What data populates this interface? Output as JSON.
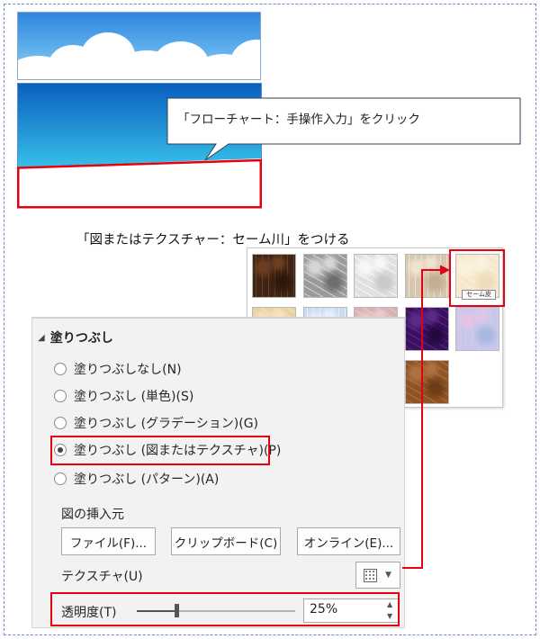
{
  "callout": {
    "text": "「フローチャート：手操作入力」をクリック"
  },
  "caption": {
    "text": "「図またはテクスチャー：セーム川」をつける"
  },
  "texture_gallery": {
    "tooltip": "セーム皮",
    "textures": [
      {
        "name": "texture-brown-marble",
        "colors": [
          "#3e2414",
          "#6b3e22",
          "#2d180c"
        ]
      },
      {
        "name": "texture-granite",
        "colors": [
          "#9a9a9a",
          "#d6d6d6",
          "#6e6e6e"
        ]
      },
      {
        "name": "texture-white-marble",
        "colors": [
          "#e0e0e0",
          "#f7f7f7",
          "#c9c9c9"
        ]
      },
      {
        "name": "texture-sand",
        "colors": [
          "#d6c6ae",
          "#eee2d0",
          "#c2ae92"
        ]
      },
      {
        "name": "texture-chamois",
        "colors": [
          "#f6e8cc",
          "#fbf2de",
          "#efdcbc"
        ]
      },
      {
        "name": "texture-papyrus",
        "colors": [
          "#ead1a2",
          "#f5e2bd",
          "#dec08c"
        ]
      },
      {
        "name": "texture-blue-tissue",
        "colors": [
          "#c9daf1",
          "#e5eefb",
          "#b3c9ea"
        ]
      },
      {
        "name": "texture-pink-tissue",
        "colors": [
          "#d9afb2",
          "#ebcacc",
          "#c89498"
        ]
      },
      {
        "name": "texture-purple-mesh",
        "colors": [
          "#3a1060",
          "#5a2a86",
          "#240840"
        ]
      },
      {
        "name": "texture-bouquet",
        "colors": [
          "#c4c9ec",
          "#e2c4e6",
          "#aab6e2"
        ]
      },
      {
        "name": "texture-cork",
        "colors": [
          "#b07848",
          "#cc9462",
          "#8e5a30"
        ]
      },
      {
        "name": "texture-walnut",
        "colors": [
          "#4a2c16",
          "#6a4226",
          "#321c0c"
        ]
      },
      {
        "name": "texture-oak",
        "colors": [
          "#b67a3a",
          "#d29a5a",
          "#9a6228"
        ]
      },
      {
        "name": "texture-medium-wood",
        "colors": [
          "#8e5424",
          "#b07040",
          "#6e3c16"
        ]
      }
    ]
  },
  "format_pane": {
    "section_title": "塗りつぶし",
    "fill_options": [
      {
        "label": "塗りつぶしなし(N)",
        "selected": false
      },
      {
        "label": "塗りつぶし (単色)(S)",
        "selected": false
      },
      {
        "label": "塗りつぶし (グラデーション)(G)",
        "selected": false
      },
      {
        "label": "塗りつぶし (図またはテクスチャ)(P)",
        "selected": true
      },
      {
        "label": "塗りつぶし (パターン)(A)",
        "selected": false
      }
    ],
    "insert_from_label": "図の挿入元",
    "buttons": {
      "file": "ファイル(F)...",
      "clipboard": "クリップボード(C)",
      "online": "オンライン(E)..."
    },
    "texture_label": "テクスチャ(U)",
    "transparency_label": "透明度(T)",
    "transparency_value": "25%",
    "transparency_fraction": 0.25
  },
  "colors": {
    "highlight": "#e60012",
    "sky_top": "#0a5fc0",
    "sky_bottom": "#3ac6ea"
  }
}
